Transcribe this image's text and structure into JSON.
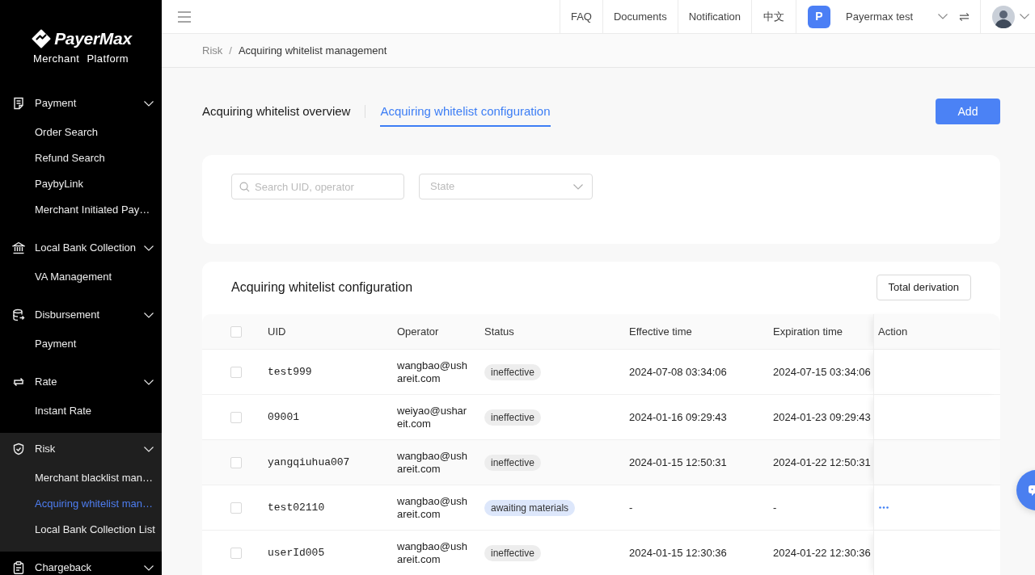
{
  "sidebar": {
    "logo": {
      "brand": "PayerMax",
      "subtitle": "Merchant Platform"
    },
    "groups": [
      {
        "label": "Payment",
        "items": [
          {
            "label": "Order Search",
            "selected": false
          },
          {
            "label": "Refund Search",
            "selected": false
          },
          {
            "label": "PaybyLink",
            "selected": false
          },
          {
            "label": "Merchant Initiated Pay…",
            "selected": false
          }
        ]
      },
      {
        "label": "Local Bank Collection",
        "items": [
          {
            "label": "VA Management",
            "selected": false
          }
        ]
      },
      {
        "label": "Disbursement",
        "items": [
          {
            "label": "Payment",
            "selected": false
          }
        ]
      },
      {
        "label": "Rate",
        "items": [
          {
            "label": "Instant Rate",
            "selected": false
          }
        ]
      },
      {
        "label": "Risk",
        "items": [
          {
            "label": "Merchant blacklist man…",
            "selected": false
          },
          {
            "label": "Acquiring whitelist man…",
            "selected": true
          },
          {
            "label": "Local Bank Collection List",
            "selected": false
          }
        ]
      },
      {
        "label": "Chargeback"
      }
    ]
  },
  "top_bar": {
    "links": [
      "FAQ",
      "Documents",
      "Notification"
    ],
    "language": "中文",
    "account": {
      "initial": "P",
      "name": "Payermax test"
    }
  },
  "breadcrumb": {
    "items": [
      "Risk",
      "Acquiring whitelist management"
    ],
    "separator": "/"
  },
  "tabs": [
    {
      "label": "Acquiring whitelist overview",
      "selected": false
    },
    {
      "label": "Acquiring whitelist configuration",
      "selected": true
    }
  ],
  "add_button": "Add",
  "filters": {
    "search": {
      "placeholder": "Search UID, operator"
    },
    "state": {
      "placeholder": "State"
    }
  },
  "table": {
    "title": "Acquiring whitelist configuration",
    "export_button": "Total derivation",
    "all_checked": false,
    "columns": [
      "UID",
      "Operator",
      "Status",
      "Effective time",
      "Expiration time",
      "Action"
    ],
    "rows": [
      {
        "checked": false,
        "hovered": false,
        "uid": "test999",
        "operator": "wangbao@ushareit.com",
        "status": {
          "label": "ineffective",
          "color": "#ededed"
        },
        "effective_time": "2024-07-08 03:34:06",
        "expiration_time": "2024-07-15 03:34:06",
        "menu": false
      },
      {
        "checked": false,
        "hovered": false,
        "uid": "09001",
        "operator": "weiyao@ushareit.com",
        "status": {
          "label": "ineffective",
          "color": "#ededed"
        },
        "effective_time": "2024-01-16 09:29:43",
        "expiration_time": "2024-01-23 09:29:43",
        "menu": false
      },
      {
        "checked": false,
        "hovered": true,
        "uid": "yangqiuhua007",
        "operator": "wangbao@ushareit.com",
        "status": {
          "label": "ineffective",
          "color": "#ededed"
        },
        "effective_time": "2024-01-15 12:50:31",
        "expiration_time": "2024-01-22 12:50:31",
        "menu": false
      },
      {
        "checked": false,
        "hovered": false,
        "uid": "test02110",
        "operator": "wangbao@ushareit.com",
        "status": {
          "label": "awaiting materials",
          "color": "#dde7fb"
        },
        "effective_time": "-",
        "expiration_time": "-",
        "menu": true
      },
      {
        "checked": false,
        "hovered": false,
        "uid": "userId005",
        "operator": "wangbao@ushareit.com",
        "status": {
          "label": "ineffective",
          "color": "#ededed"
        },
        "effective_time": "2024-01-15 12:30:36",
        "expiration_time": "2024-01-22 12:30:36",
        "menu": false
      }
    ]
  }
}
